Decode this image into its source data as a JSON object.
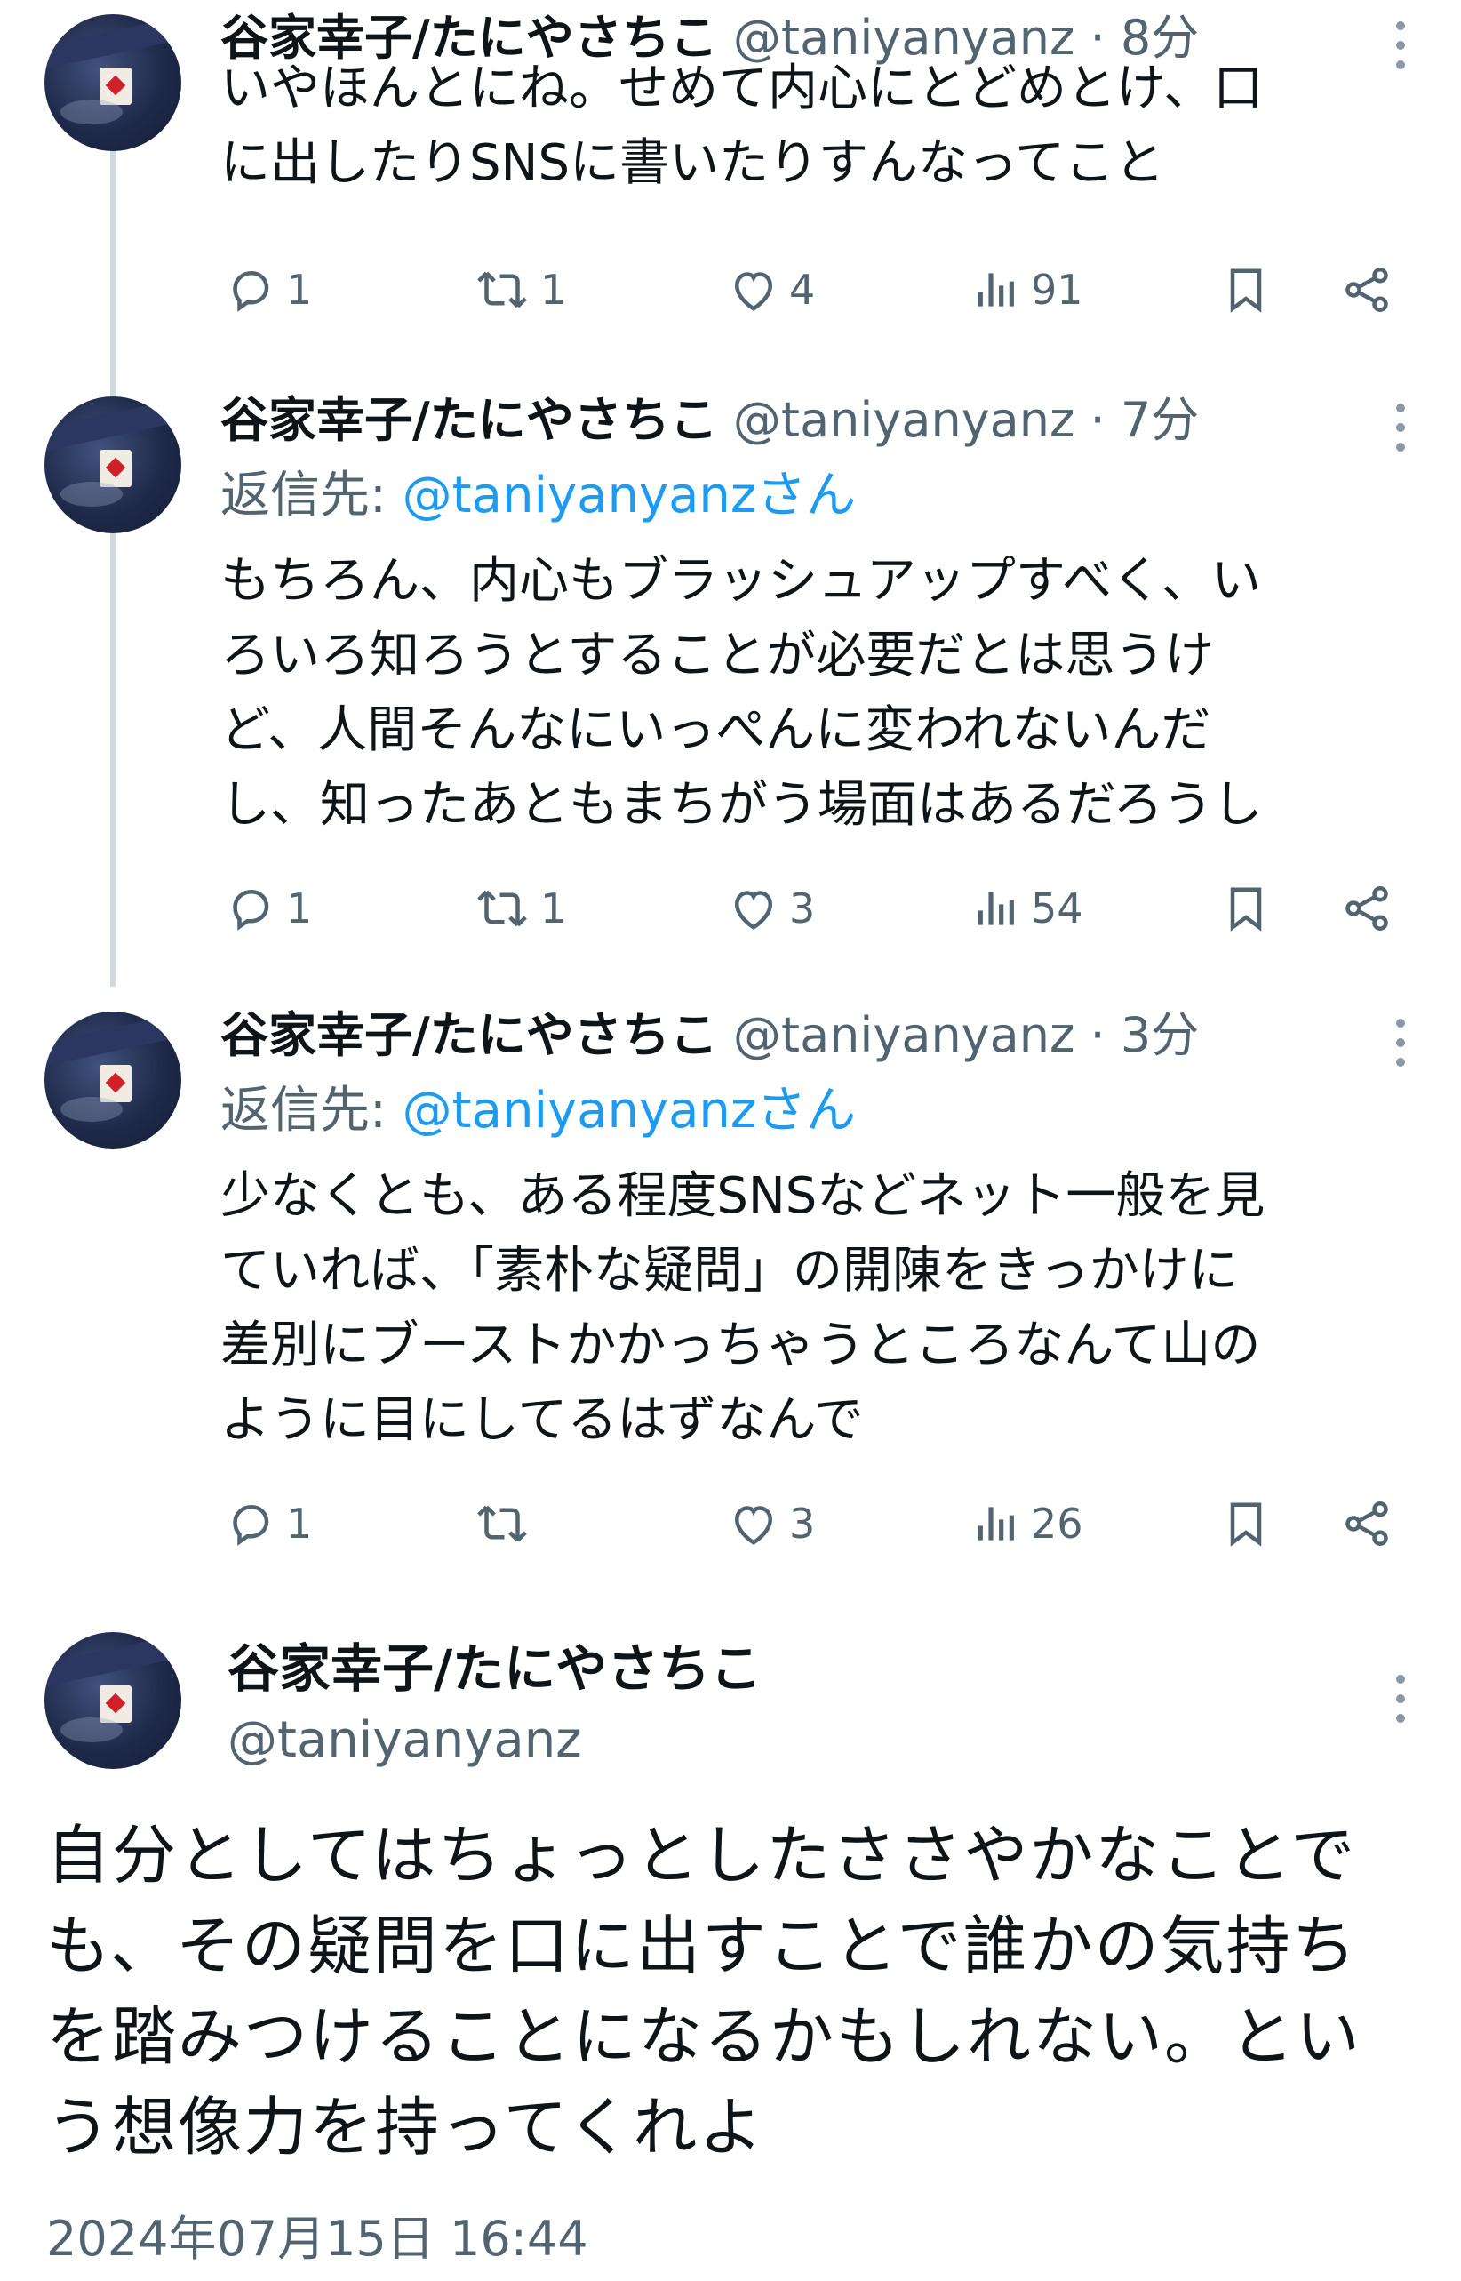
{
  "thread": [
    {
      "name": "谷家幸子/たにやさちこ",
      "handle": "@taniyanyanz",
      "time": "8分",
      "reply_to_label": "",
      "reply_to_link": "",
      "text": "いやほんとにね。せめて内心にとどめとけ、口\nに出したりSNSに書いたりすんなってこと",
      "replies": "1",
      "reposts": "1",
      "likes": "4",
      "views": "91"
    },
    {
      "name": "谷家幸子/たにやさちこ",
      "handle": "@taniyanyanz",
      "time": "7分",
      "reply_to_label": "返信先: ",
      "reply_to_link": "@taniyanyanzさん",
      "text": "もちろん、内心もブラッシュアップすべく、い\nろいろ知ろうとすることが必要だとは思うけ\nど、人間そんなにいっぺんに変われないんだ\nし、知ったあともまちがう場面はあるだろうし",
      "replies": "1",
      "reposts": "1",
      "likes": "3",
      "views": "54"
    },
    {
      "name": "谷家幸子/たにやさちこ",
      "handle": "@taniyanyanz",
      "time": "3分",
      "reply_to_label": "返信先: ",
      "reply_to_link": "@taniyanyanzさん",
      "text": "少なくとも、ある程度SNSなどネット一般を見\nていれば、「素朴な疑問」の開陳をきっかけに\n差別にブーストかかっちゃうところなんて山の\nように目にしてるはずなんで",
      "replies": "1",
      "reposts": "",
      "likes": "3",
      "views": "26"
    }
  ],
  "main": {
    "name": "谷家幸子/たにやさちこ",
    "handle": "@taniyanyanz",
    "text": "自分としてはちょっとしたささやかなことで\nも、その疑問を口に出すことで誰かの気持ち\nを踏みつけることになるかもしれない。とい\nう想像力を持ってくれよ",
    "timestamp": "2024年07月15日 16:44"
  },
  "separator": "·",
  "colors": {
    "text": "#0f1419",
    "secondary": "#536471",
    "link": "#1d9bf0",
    "thread_line": "#cfd9de"
  },
  "icons": [
    "reply-icon",
    "repost-icon",
    "like-icon",
    "views-icon",
    "bookmark-icon",
    "share-icon",
    "more-icon"
  ]
}
